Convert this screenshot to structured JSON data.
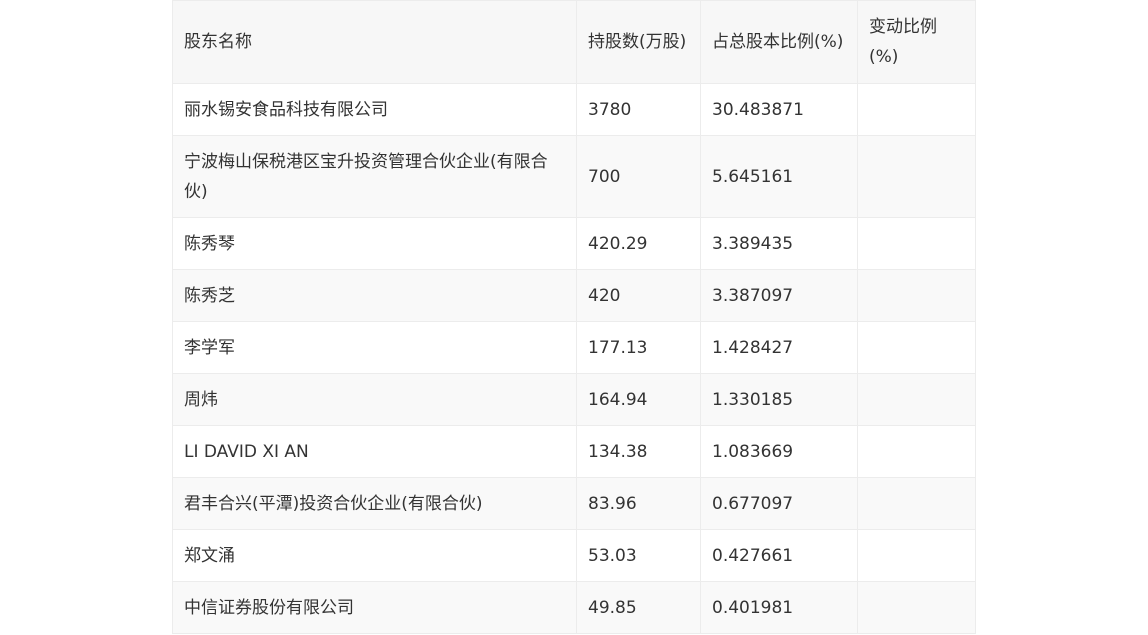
{
  "table": {
    "headers": [
      "股东名称",
      "持股数(万股)",
      "占总股本比例(%)",
      "变动比例(%)"
    ],
    "rows": [
      [
        "丽水锡安食品科技有限公司",
        "3780",
        "30.483871",
        ""
      ],
      [
        "宁波梅山保税港区宝升投资管理合伙企业(有限合伙)",
        "700",
        "5.645161",
        ""
      ],
      [
        "陈秀琴",
        "420.29",
        "3.389435",
        ""
      ],
      [
        "陈秀芝",
        "420",
        "3.387097",
        ""
      ],
      [
        "李学军",
        "177.13",
        "1.428427",
        ""
      ],
      [
        "周炜",
        "164.94",
        "1.330185",
        ""
      ],
      [
        "LI DAVID XI AN",
        "134.38",
        "1.083669",
        ""
      ],
      [
        "君丰合兴(平潭)投资合伙企业(有限合伙)",
        "83.96",
        "0.677097",
        ""
      ],
      [
        "郑文涌",
        "53.03",
        "0.427661",
        ""
      ],
      [
        "中信证券股份有限公司",
        "49.85",
        "0.401981",
        ""
      ]
    ]
  }
}
